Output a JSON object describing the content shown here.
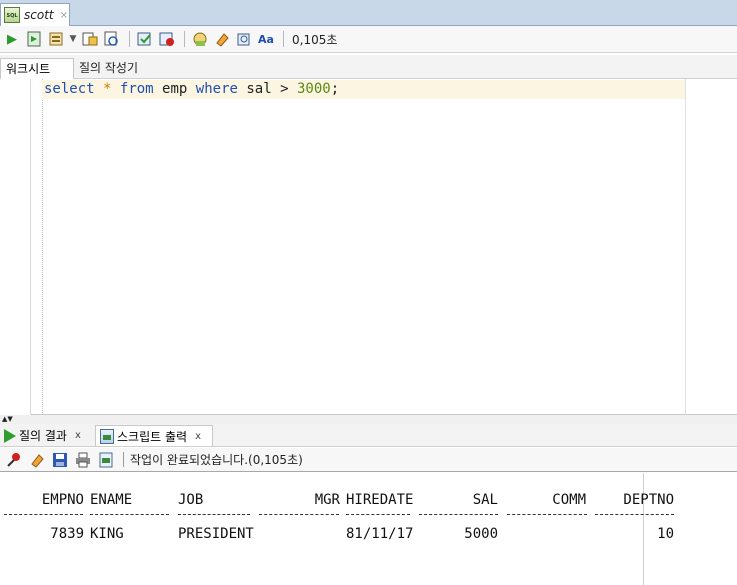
{
  "doc_tab": {
    "name": "scott",
    "close": "×",
    "icon": "sql-file-icon"
  },
  "toolbar": {
    "icons": [
      "run-statement-icon",
      "run-script-icon",
      "commit-icon",
      "dropdown-arrow-icon",
      "explain-plan-icon",
      "autotrace-icon",
      "commit-check-icon",
      "rollback-icon",
      "sql-tuning-icon",
      "clear-eraser-icon",
      "history-icon",
      "format-case-icon"
    ],
    "elapsed": "0,105초"
  },
  "subtabs": {
    "worksheet": "워크시트",
    "query_builder": "질의 작성기"
  },
  "editor": {
    "tokens": {
      "select": "select",
      "star": "*",
      "from": "from",
      "table": "emp",
      "where": "where",
      "column": "sal",
      "op": ">",
      "value": "3000",
      "end": ";"
    }
  },
  "result_tabs": [
    {
      "label": "질의 결과",
      "close": "x"
    },
    {
      "label": "스크립트 출력",
      "close": "x"
    }
  ],
  "output_toolbar": {
    "icons": [
      "pin-icon",
      "eraser-icon",
      "save-icon",
      "print-icon",
      "script-output-icon"
    ],
    "status": "작업이 완료되었습니다.(0,105초)"
  },
  "output": {
    "columns": [
      "EMPNO",
      "ENAME",
      "JOB",
      "MGR",
      "HIREDATE",
      "SAL",
      "COMM",
      "DEPTNO"
    ],
    "rows": [
      [
        "7839",
        "KING",
        "PRESIDENT",
        "",
        "81/11/17",
        "5000",
        "",
        "10"
      ]
    ]
  },
  "colors": {
    "keyword": "#1f4fb0",
    "number": "#5a8a14",
    "operator_star": "#c77b00",
    "current_line": "#fbf5e2",
    "tab_strip": "#c9d8e9"
  }
}
